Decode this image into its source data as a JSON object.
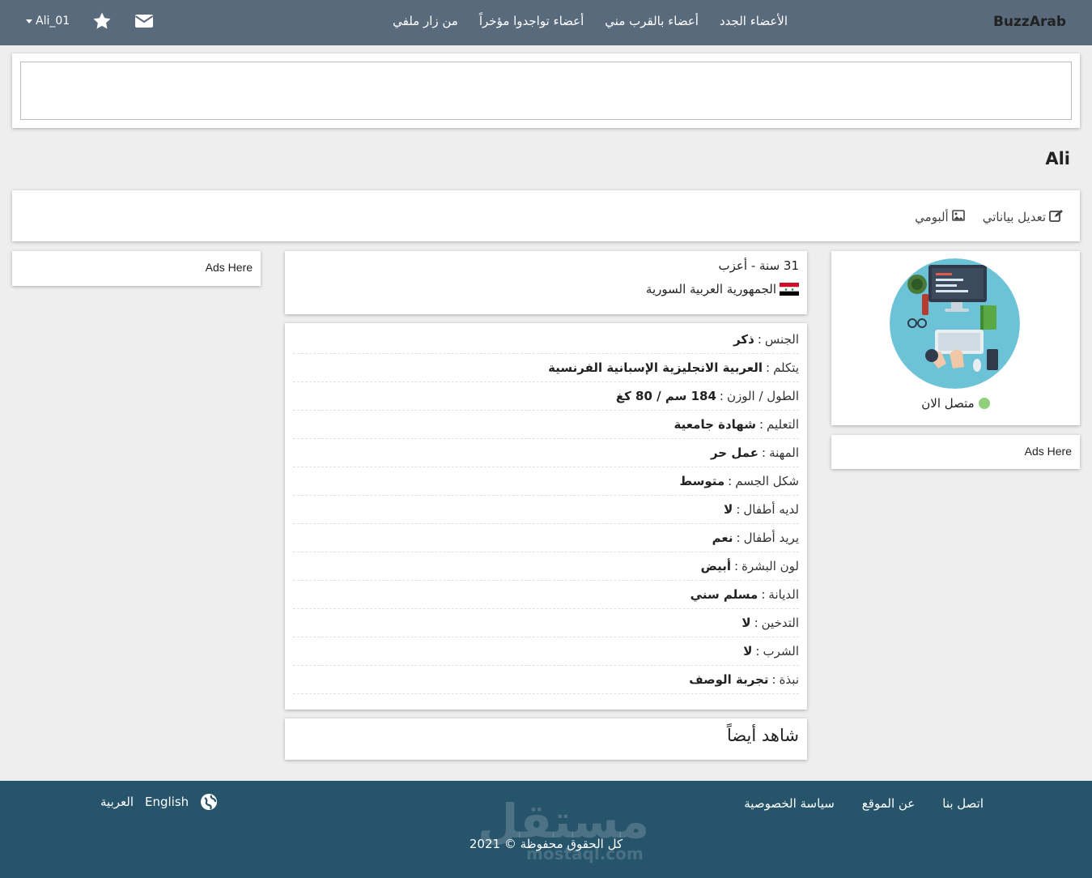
{
  "navbar": {
    "brand": "BuzzArab",
    "links": [
      "الأعضاء الجدد",
      "أعضاء بالقرب مني",
      "أعضاء تواجدوا مؤخراً",
      "من زار ملفي"
    ],
    "username": "Ali_01",
    "icons": [
      "envelope-icon",
      "star-icon",
      "caret-down-icon"
    ]
  },
  "search": {
    "value": ""
  },
  "profile": {
    "title": "Ali",
    "tabs": {
      "edit_label": "تعديل بياناتي",
      "album_label": "ألبومي"
    },
    "age_status": "31 سنة - أعزب",
    "country": "الجمهورية العربية السورية",
    "online_status": "متصل الان",
    "online_color": "#8fd17a"
  },
  "details": [
    {
      "label": "الجنس",
      "value": "ذكر"
    },
    {
      "label": "يتكلم",
      "value": "العربية الانجليزية الإسبانية الفرنسية"
    },
    {
      "label": "الطول / الوزن",
      "value": "184 سم / 80 كغ"
    },
    {
      "label": "التعليم",
      "value": "شهادة جامعية"
    },
    {
      "label": "المهنة",
      "value": "عمل حر"
    },
    {
      "label": "شكل الجسم",
      "value": "متوسط"
    },
    {
      "label": "لديه أطفال",
      "value": "لا"
    },
    {
      "label": "يريد أطفال",
      "value": "نعم"
    },
    {
      "label": "لون البشرة",
      "value": "أبيض"
    },
    {
      "label": "الديانة",
      "value": "مسلم سني"
    },
    {
      "label": "التدخين",
      "value": "لا"
    },
    {
      "label": "الشرب",
      "value": "لا"
    },
    {
      "label": "نبذة",
      "value": "تجربة الوصف"
    }
  ],
  "see_also": "شاهد أيضاً",
  "ads": {
    "left": "Ads Here",
    "right": "Ads Here"
  },
  "footer": {
    "links": [
      "اتصل بنا",
      "عن الموقع",
      "سياسة الخصوصية"
    ],
    "languages": [
      "English",
      "العربية"
    ],
    "copyright": "كل الحقوق محفوظة © 2021",
    "watermark": "مستقل",
    "watermark_sub": "mostaql.com"
  },
  "colors": {
    "navbar": "#5a6a7d",
    "footer": "#26546b",
    "background": "#efeeee"
  }
}
